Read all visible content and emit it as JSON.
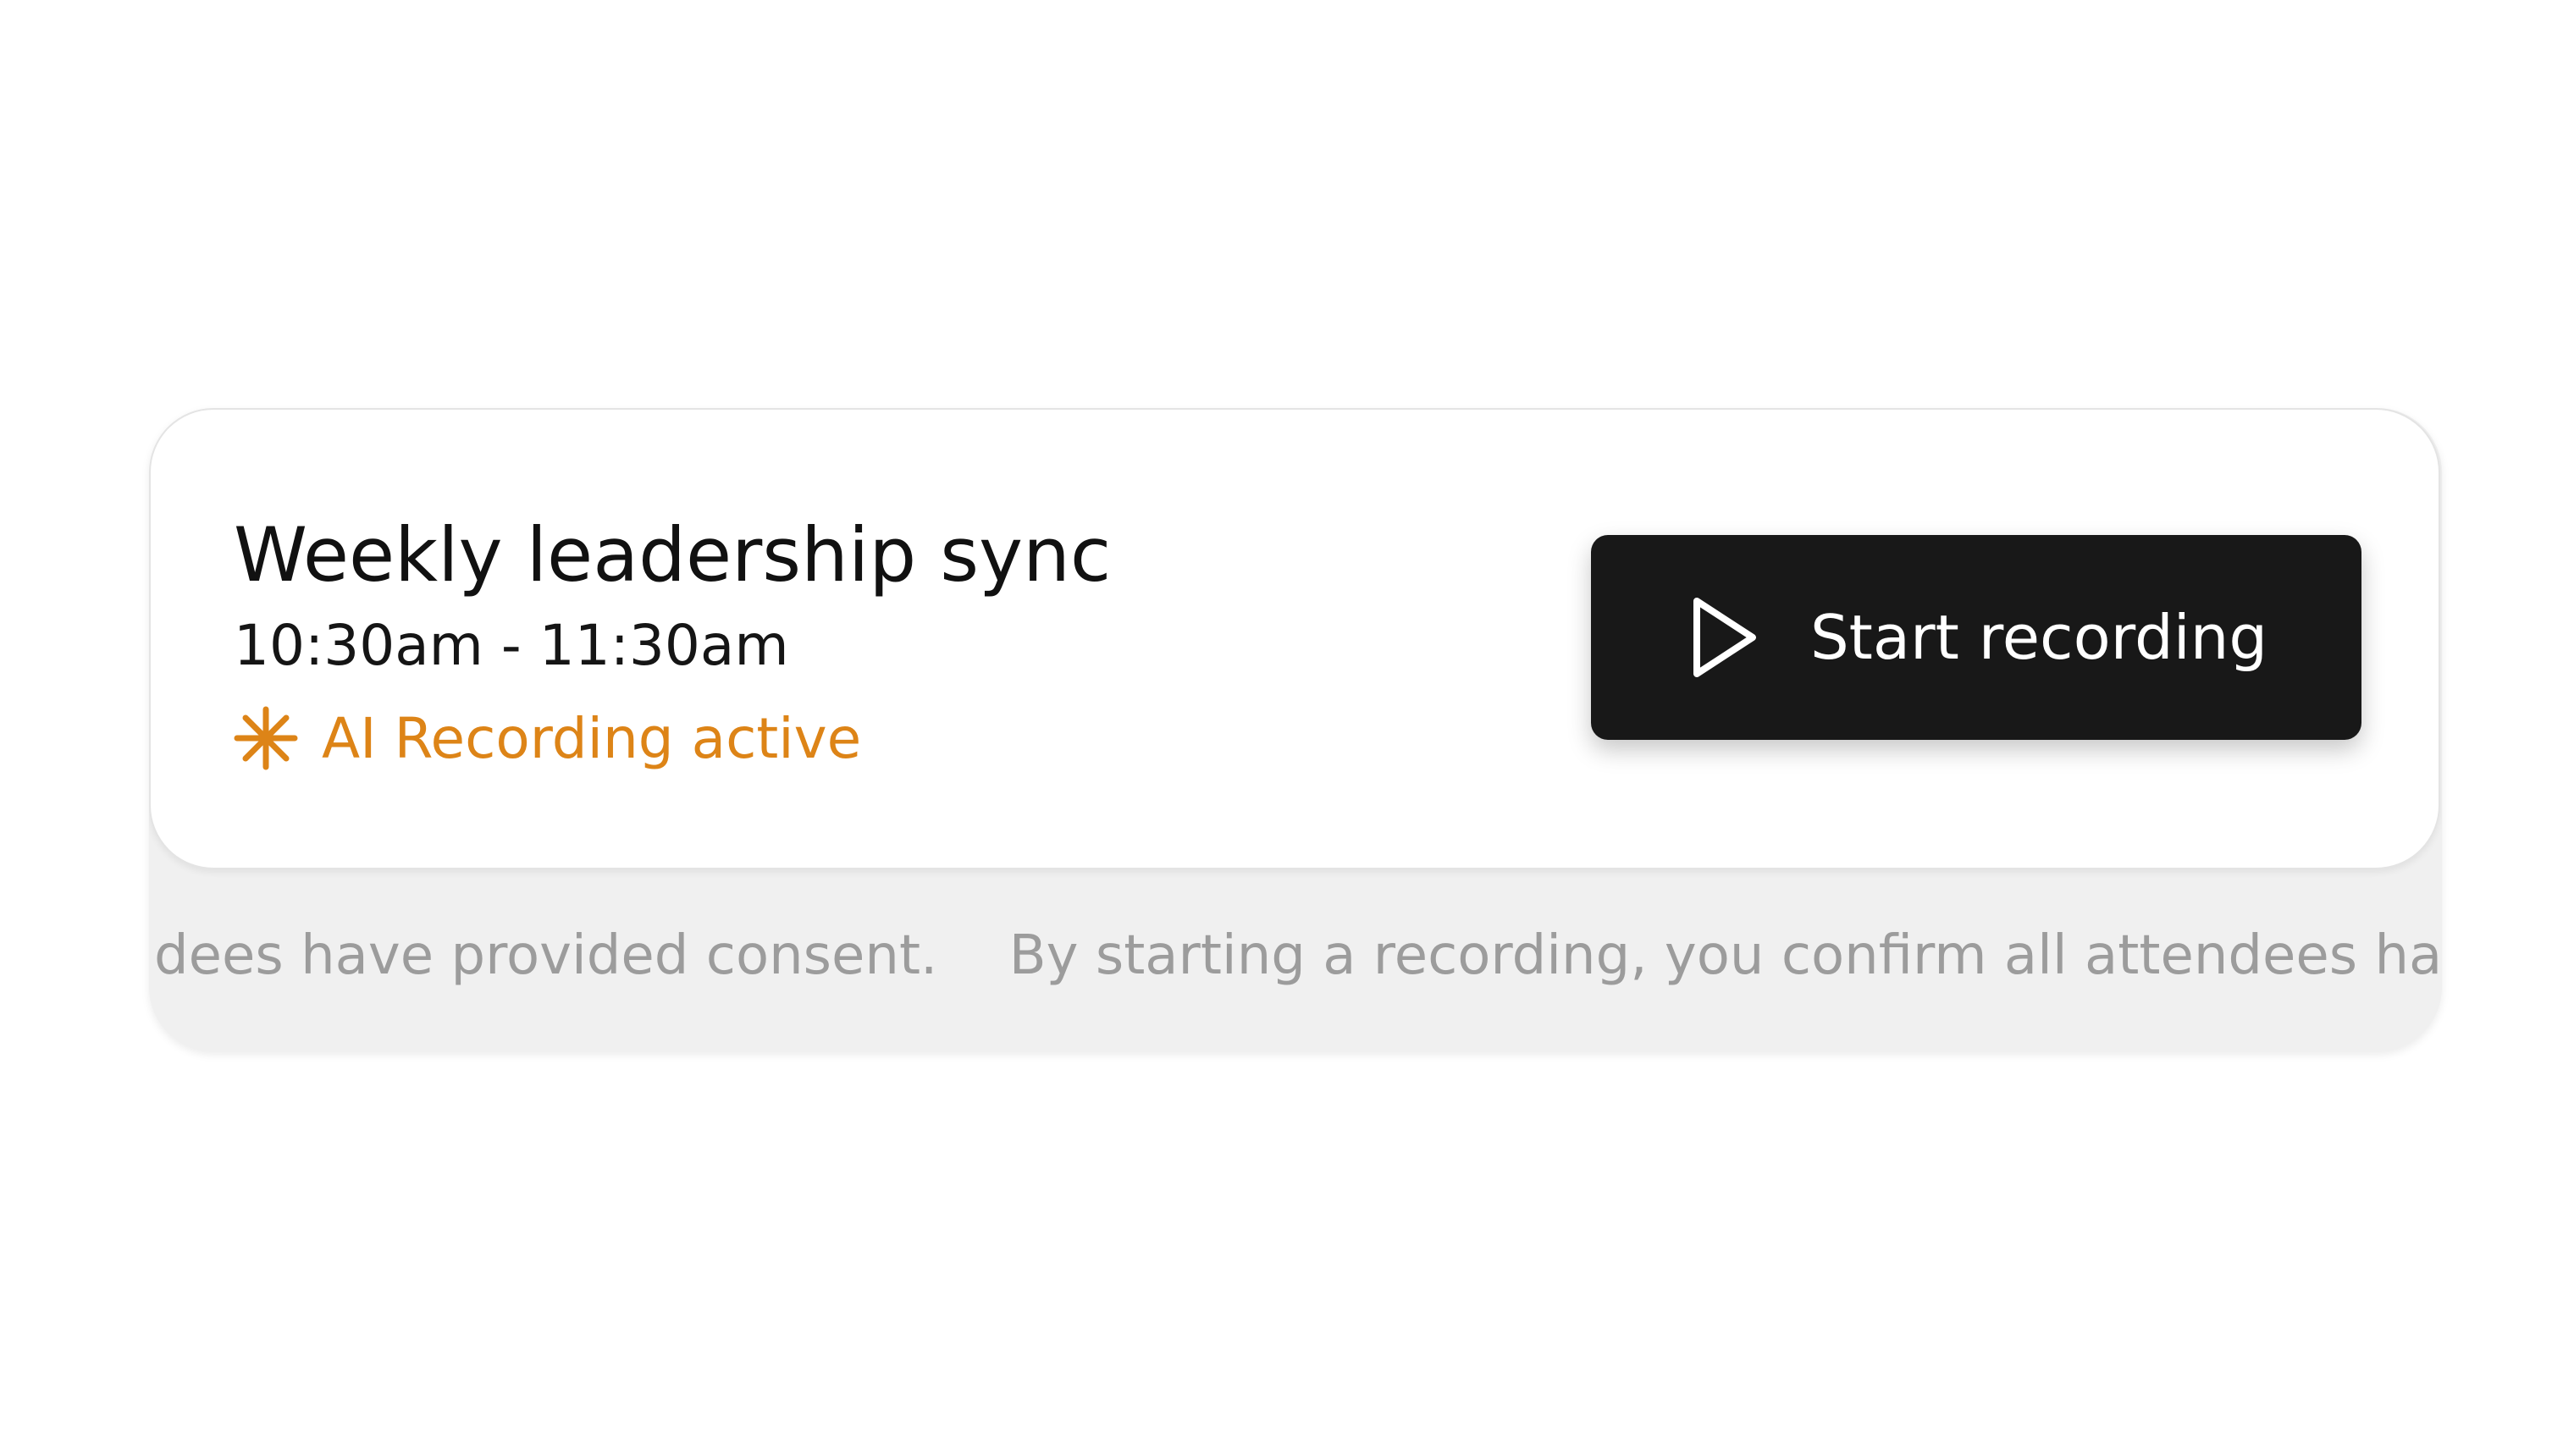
{
  "meeting": {
    "title": "Weekly leadership sync",
    "time": "10:30am - 11:30am"
  },
  "status": {
    "label": "AI Recording active",
    "icon": "spark-icon",
    "color": "#dd8417"
  },
  "actions": {
    "start_recording_label": "Start recording",
    "icon": "play-icon",
    "button_color": "#181818"
  },
  "consent": {
    "visible_start": "dees have provided consent.",
    "visible_end": "By starting a recording, you confirm all attendees have"
  }
}
